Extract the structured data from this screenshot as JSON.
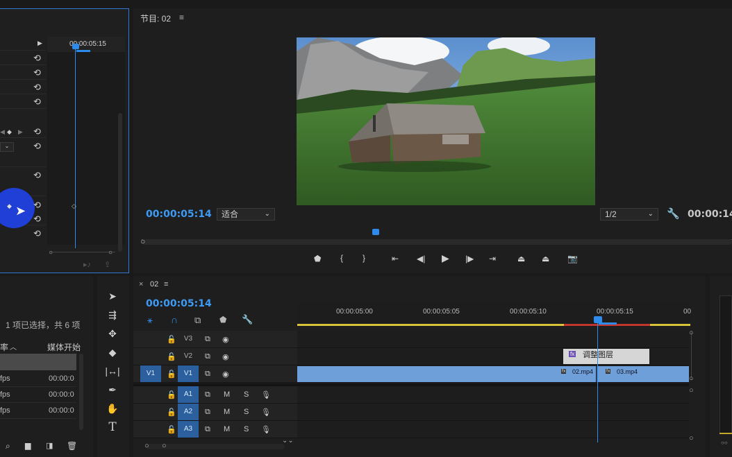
{
  "effect_controls": {
    "timecode": "00:00:05:15"
  },
  "program_monitor": {
    "title": "节目: 02",
    "menu_icon": "menu-icon",
    "current_time": "00:00:05:14",
    "fit_option": "适合",
    "resolution": "1/2",
    "duration": "00:00:14:",
    "scene": "wooden-cabin-mountain-meadow"
  },
  "project": {
    "selection_status": "1 项已选择，共 6 项",
    "col_rate": "率",
    "col_media_start": "媒体开始",
    "rows": [
      {
        "rate": "fps",
        "start": "00:00:0"
      },
      {
        "rate": "fps",
        "start": "00:00:0"
      },
      {
        "rate": "fps",
        "start": "00:00:0"
      }
    ]
  },
  "timeline": {
    "sequence_name": "02",
    "current_time": "00:00:05:14",
    "ruler_labels": [
      "00:00:05:00",
      "00:00:05:05",
      "00:00:05:10",
      "00:00:05:15",
      "00"
    ],
    "video_tracks": [
      "V3",
      "V2",
      "V1"
    ],
    "audio_tracks": [
      "A1",
      "A2",
      "A3"
    ],
    "source_v": "V1",
    "mute": "M",
    "solo": "S",
    "adjustment_clip": "调整图层",
    "clip1": "02.mp4",
    "clip2": "03.mp4",
    "fx": "fx"
  }
}
